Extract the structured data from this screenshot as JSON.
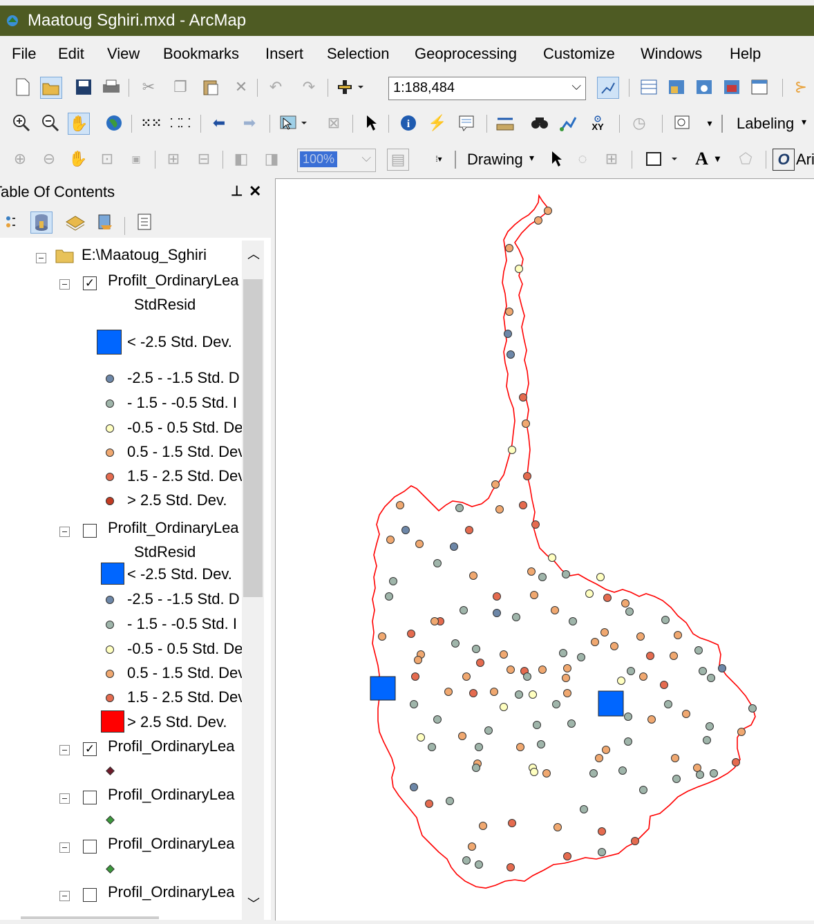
{
  "window": {
    "title": "Maatoug Sghiri.mxd - ArcMap"
  },
  "menu": [
    "File",
    "Edit",
    "View",
    "Bookmarks",
    "Insert",
    "Selection",
    "Geoprocessing",
    "Customize",
    "Windows",
    "Help"
  ],
  "toolbar": {
    "scale_value": "1:188,484",
    "labeling_label": "Labeling",
    "zoom_value": "100%",
    "drawing_label": "Drawing",
    "font_label": "Ari"
  },
  "toc": {
    "title": "Table Of Contents",
    "pin": "ᵖ",
    "close": "✕",
    "root": "E:\\Maatoug_Sghiri",
    "layer1": "Profilt_OrdinaryLea",
    "layer1_field": "StdResid",
    "layer2": "Profilt_OrdinaryLea",
    "layer2_field": "StdResid",
    "layer3": "Profil_OrdinaryLea",
    "layer4": "Profil_OrdinaryLea",
    "layer5": "Profil_OrdinaryLea",
    "layer6": "Profil_OrdinaryLea",
    "classes": [
      "< -2.5 Std. Dev.",
      "-2.5 - -1.5 Std. D",
      "- 1.5 - -0.5 Std. I",
      "-0.5 - 0.5 Std. De",
      "0.5 - 1.5 Std. Dev",
      "1.5 - 2.5 Std. Dev",
      "> 2.5 Std. Dev."
    ]
  },
  "colors": {
    "title_bar": "#4e5b23",
    "class_lt_m25": "#0066ff",
    "class_m25_m15": "#6d87a8",
    "class_m15_m05": "#9fb5aa",
    "class_m05_05": "#ffffc0",
    "class_05_15": "#f0a870",
    "class_15_25": "#e56b4f",
    "class_gt_25": "#c23b22",
    "class_gt_25_layer2": "#ff0000",
    "boundary": "#ff0000"
  },
  "icons": [
    "arcmap-icon",
    "new-doc-icon",
    "open-icon",
    "save-icon",
    "print-icon",
    "cut-icon",
    "copy-icon",
    "paste-icon",
    "delete-icon",
    "undo-icon",
    "redo-icon",
    "add-data-icon",
    "zoom-in-icon",
    "zoom-out-icon",
    "pan-icon",
    "globe-icon",
    "identify-icon",
    "find-icon",
    "select-arrow-icon"
  ]
}
